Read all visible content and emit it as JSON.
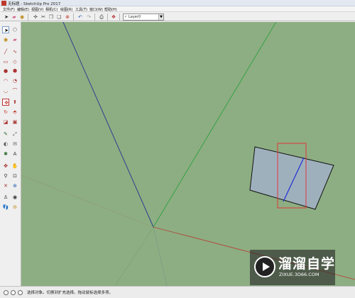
{
  "window": {
    "title": "无标题 - SketchUp Pro 2017"
  },
  "menu": {
    "items": [
      "文件(F)",
      "编辑(E)",
      "视图(V)",
      "相机(C)",
      "绘图(R)",
      "工具(T)",
      "窗口(W)",
      "帮助(H)"
    ]
  },
  "toolbar": {
    "layer_dropdown_value": "Layer0",
    "layer_dropdown_check": "✓"
  },
  "status": {
    "message": "选择对象。切换到扩充选择。拖动鼠标选择多项。"
  },
  "watermark": {
    "brand": "溜溜自学",
    "url": "ZIXUE.3D66.COM"
  },
  "colors": {
    "viewport_bg": "#8dae82",
    "axis_blue": "#2d3f8f",
    "axis_green": "#2ea043",
    "axis_red": "#b3473a",
    "face_fill": "#9fb0bd",
    "selection_box": "#e3343b",
    "edge_blue": "#1f2fd6"
  },
  "icons": {
    "toolbar": [
      "select-icon",
      "eraser-icon",
      "paint-bucket-icon",
      "orbit-icon",
      "delete-icon",
      "undo-icon",
      "redo-icon",
      "print-icon",
      "model-info-icon",
      "layer-icon"
    ],
    "palette": [
      "select-arrow-icon",
      "make-component-icon",
      "paint-bucket-icon",
      "eraser-icon",
      "line-icon",
      "freehand-icon",
      "rectangle-icon",
      "rotated-rectangle-icon",
      "circle-icon",
      "polygon-icon",
      "arc-icon",
      "pie-icon",
      "move-icon",
      "push-pull-icon",
      "rotate-icon",
      "follow-me-icon",
      "scale-icon",
      "offset-icon",
      "tape-measure-icon",
      "dimension-icon",
      "protractor-icon",
      "text-icon",
      "axes-icon",
      "3d-text-icon",
      "orbit-icon",
      "pan-icon",
      "zoom-icon",
      "zoom-window-icon",
      "zoom-extents-icon",
      "previous-view-icon",
      "position-camera-icon",
      "look-around-icon",
      "walk-icon",
      "section-plane-icon"
    ]
  }
}
